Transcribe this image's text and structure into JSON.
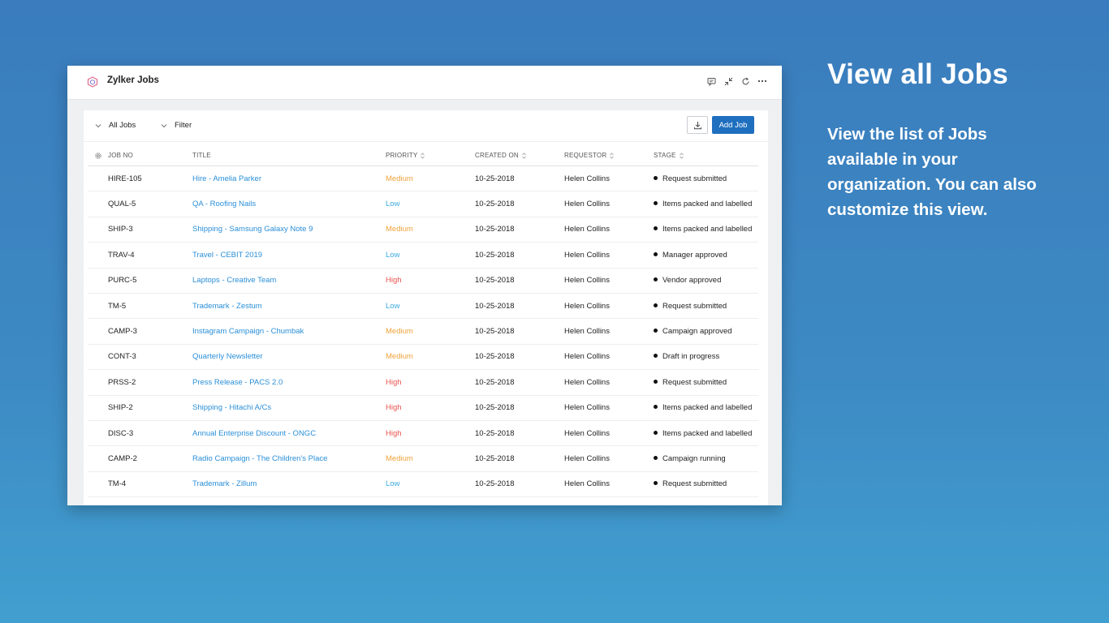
{
  "app": {
    "title": "Zylker Jobs"
  },
  "toolbar": {
    "view_label": "All Jobs",
    "filter_label": "Filter",
    "add_label": "Add Job"
  },
  "table": {
    "headers": {
      "job_no": "JOB NO",
      "title": "TITLE",
      "priority": "PRIORITY",
      "created_on": "CREATED ON",
      "requestor": "REQUESTOR",
      "stage": "STAGE"
    },
    "rows": [
      {
        "job_no": "HIRE-105",
        "title": "Hire - Amelia Parker",
        "priority": "Medium",
        "created_on": "10-25-2018",
        "requestor": "Helen Collins",
        "stage": "Request submitted"
      },
      {
        "job_no": "QUAL-5",
        "title": "QA - Roofing Nails",
        "priority": "Low",
        "created_on": "10-25-2018",
        "requestor": "Helen Collins",
        "stage": "Items packed and labelled"
      },
      {
        "job_no": "SHIP-3",
        "title": "Shipping - Samsung Galaxy Note 9",
        "priority": "Medium",
        "created_on": "10-25-2018",
        "requestor": "Helen Collins",
        "stage": "Items packed and labelled"
      },
      {
        "job_no": "TRAV-4",
        "title": "Travel - CEBIT 2019",
        "priority": "Low",
        "created_on": "10-25-2018",
        "requestor": "Helen Collins",
        "stage": "Manager approved"
      },
      {
        "job_no": "PURC-5",
        "title": "Laptops - Creative Team",
        "priority": "High",
        "created_on": "10-25-2018",
        "requestor": "Helen Collins",
        "stage": "Vendor approved"
      },
      {
        "job_no": "TM-5",
        "title": "Trademark - Zestum",
        "priority": "Low",
        "created_on": "10-25-2018",
        "requestor": "Helen Collins",
        "stage": "Request submitted"
      },
      {
        "job_no": "CAMP-3",
        "title": "Instagram Campaign - Chumbak",
        "priority": "Medium",
        "created_on": "10-25-2018",
        "requestor": "Helen Collins",
        "stage": "Campaign approved"
      },
      {
        "job_no": "CONT-3",
        "title": "Quarterly Newsletter",
        "priority": "Medium",
        "created_on": "10-25-2018",
        "requestor": "Helen Collins",
        "stage": "Draft in progress"
      },
      {
        "job_no": "PRSS-2",
        "title": "Press Release - PACS 2.0",
        "priority": "High",
        "created_on": "10-25-2018",
        "requestor": "Helen Collins",
        "stage": "Request submitted"
      },
      {
        "job_no": "SHIP-2",
        "title": "Shipping - Hitachi A/Cs",
        "priority": "High",
        "created_on": "10-25-2018",
        "requestor": "Helen Collins",
        "stage": "Items packed and labelled"
      },
      {
        "job_no": "DISC-3",
        "title": "Annual Enterprise Discount - ONGC",
        "priority": "High",
        "created_on": "10-25-2018",
        "requestor": "Helen Collins",
        "stage": "Items packed and labelled"
      },
      {
        "job_no": "CAMP-2",
        "title": "Radio Campaign - The Children's Place",
        "priority": "Medium",
        "created_on": "10-25-2018",
        "requestor": "Helen Collins",
        "stage": "Campaign running"
      },
      {
        "job_no": "TM-4",
        "title": "Trademark - Zillum",
        "priority": "Low",
        "created_on": "10-25-2018",
        "requestor": "Helen Collins",
        "stage": "Request submitted"
      }
    ]
  },
  "promo": {
    "title": "View all Jobs",
    "body": "View the list of Jobs available in your organization. You can also customize this view."
  },
  "colors": {
    "accent": "#1f6fbf",
    "link": "#2a8fd8",
    "priority_medium": "#f0a33a",
    "priority_low": "#38a8e0",
    "priority_high": "#e9534f"
  },
  "icons": {
    "title_actions": [
      "comment-icon",
      "collapse-icon",
      "refresh-icon",
      "more-icon"
    ],
    "toolbar": [
      "chevron-down-icon",
      "download-icon"
    ],
    "table": [
      "settings-icon",
      "sort-icon"
    ]
  }
}
